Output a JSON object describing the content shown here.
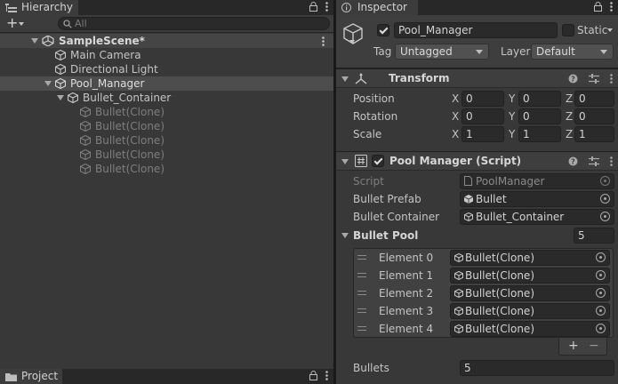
{
  "hierarchy": {
    "tab_label": "Hierarchy",
    "add_label": "+",
    "search_placeholder": "All",
    "scene_name": "SampleScene*",
    "items": [
      {
        "label": "Main Camera"
      },
      {
        "label": "Directional Light"
      },
      {
        "label": "Pool_Manager"
      },
      {
        "label": "Bullet_Container"
      },
      {
        "label": "Bullet(Clone)"
      },
      {
        "label": "Bullet(Clone)"
      },
      {
        "label": "Bullet(Clone)"
      },
      {
        "label": "Bullet(Clone)"
      },
      {
        "label": "Bullet(Clone)"
      }
    ]
  },
  "project": {
    "tab_label": "Project"
  },
  "inspector": {
    "tab_label": "Inspector",
    "object_name": "Pool_Manager",
    "static_label": "Static",
    "tag_label": "Tag",
    "tag_value": "Untagged",
    "layer_label": "Layer",
    "layer_value": "Default",
    "transform": {
      "title": "Transform",
      "rows": [
        {
          "label": "Position",
          "x": "0",
          "y": "0",
          "z": "0"
        },
        {
          "label": "Rotation",
          "x": "0",
          "y": "0",
          "z": "0"
        },
        {
          "label": "Scale",
          "x": "1",
          "y": "1",
          "z": "1"
        }
      ],
      "axis_x": "X",
      "axis_y": "Y",
      "axis_z": "Z"
    },
    "script_component": {
      "title": "Pool Manager (Script)",
      "script_label": "Script",
      "script_value": "PoolManager",
      "prefab_label": "Bullet Prefab",
      "prefab_value": "Bullet",
      "container_label": "Bullet Container",
      "container_value": "Bullet_Container",
      "pool_label": "Bullet Pool",
      "pool_size": "5",
      "elements": [
        {
          "label": "Element 0",
          "value": "Bullet(Clone)"
        },
        {
          "label": "Element 1",
          "value": "Bullet(Clone)"
        },
        {
          "label": "Element 2",
          "value": "Bullet(Clone)"
        },
        {
          "label": "Element 3",
          "value": "Bullet(Clone)"
        },
        {
          "label": "Element 4",
          "value": "Bullet(Clone)"
        }
      ],
      "add_label": "+",
      "remove_label": "−",
      "bullets_label": "Bullets",
      "bullets_value": "5"
    }
  }
}
